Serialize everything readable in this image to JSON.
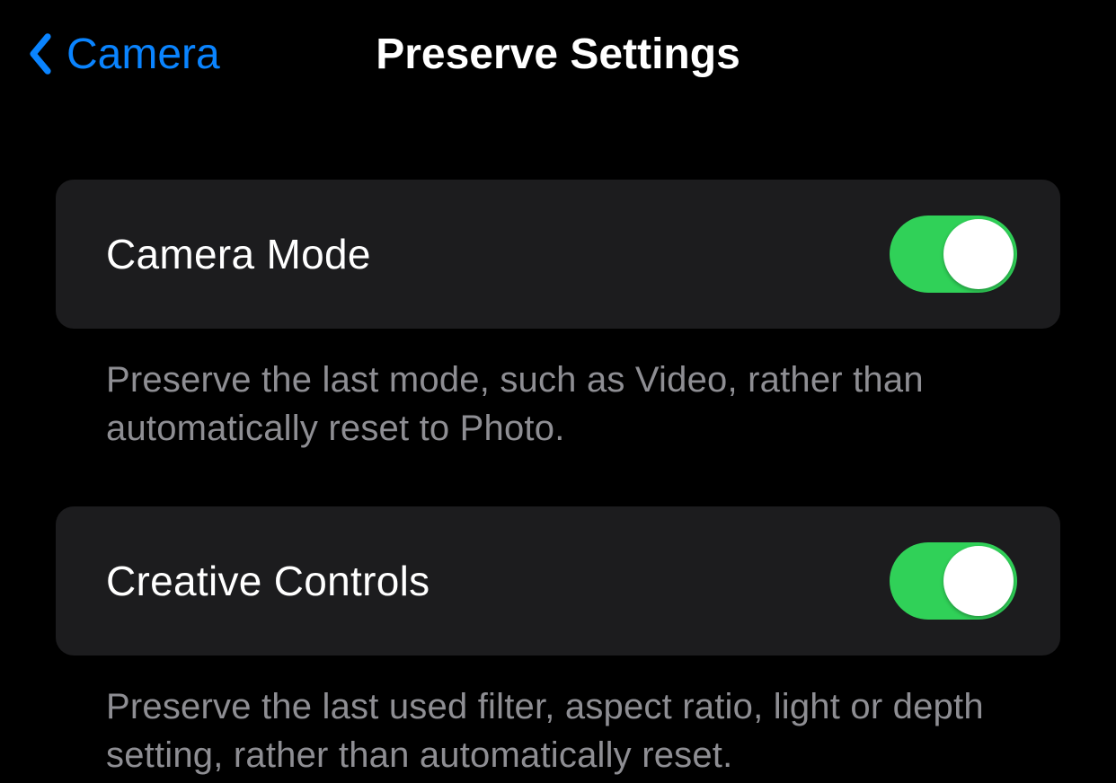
{
  "nav": {
    "back_label": "Camera",
    "title": "Preserve Settings"
  },
  "settings": [
    {
      "label": "Camera Mode",
      "description": "Preserve the last mode, such as Video, rather than automatically reset to Photo.",
      "enabled": true
    },
    {
      "label": "Creative Controls",
      "description": "Preserve the last used filter, aspect ratio, light or depth setting, rather than automatically reset.",
      "enabled": true
    }
  ]
}
